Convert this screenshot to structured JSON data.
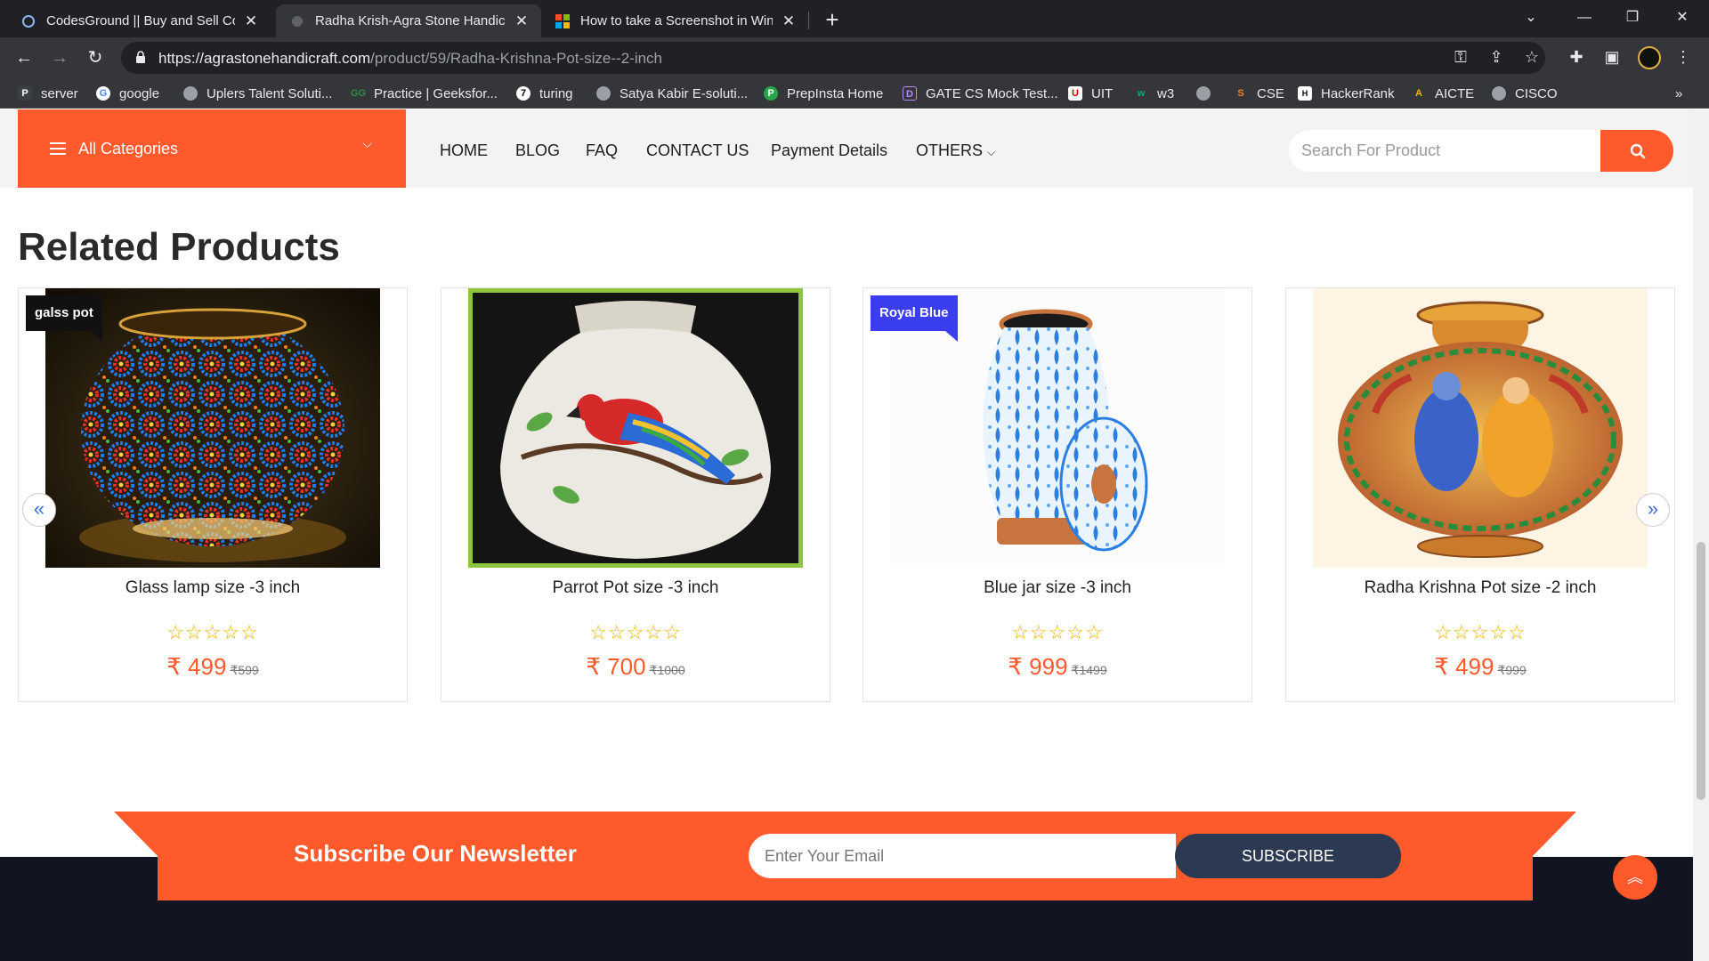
{
  "browser": {
    "tabs": [
      {
        "title": "CodesGround || Buy and Sell Cod",
        "active": false
      },
      {
        "title": "Radha Krish-Agra Stone Handicra",
        "active": true
      },
      {
        "title": "How to take a Screenshot in Win",
        "active": false
      }
    ],
    "url_host": "https://agrastonehandicraft.com",
    "url_path": "/product/59/Radha-Krishna-Pot-size--2-inch",
    "bookmarks": [
      "server",
      "google",
      "Uplers Talent Soluti...",
      "Practice | Geeksfor...",
      "turing",
      "Satya Kabir E-soluti...",
      "PrepInsta Home",
      "GATE CS Mock Test...",
      "UIT",
      "w3",
      "",
      "CSE",
      "HackerRank",
      "AICTE",
      "CISCO"
    ]
  },
  "header": {
    "categories_label": "All Categories",
    "nav": [
      "HOME",
      "BLOG",
      "FAQ",
      "CONTACT US",
      "Payment Details",
      "OTHERS"
    ],
    "search_placeholder": "Search For Product"
  },
  "related": {
    "title": "Related Products",
    "products": [
      {
        "name": "Glass lamp size -3 inch",
        "badge": "galss pot",
        "price": "₹ 499",
        "old_price": "₹599",
        "rating": 0
      },
      {
        "name": "Parrot Pot size -3 inch",
        "badge": "",
        "price": "₹ 700",
        "old_price": "₹1000",
        "rating": 0
      },
      {
        "name": "Blue jar size -3 inch",
        "badge": "Royal Blue",
        "price": "₹ 999",
        "old_price": "₹1499",
        "rating": 0
      },
      {
        "name": "Radha Krishna Pot size -2 inch",
        "badge": "",
        "price": "₹ 499",
        "old_price": "₹999",
        "rating": 0
      }
    ]
  },
  "newsletter": {
    "title": "Subscribe Our Newsletter",
    "placeholder": "Enter Your Email",
    "button": "SUBSCRIBE"
  },
  "colors": {
    "accent": "#ff5a2c",
    "badge_blue": "#3b3ef0",
    "footer_bg": "#121521",
    "subscribe_btn": "#2b3a52"
  }
}
